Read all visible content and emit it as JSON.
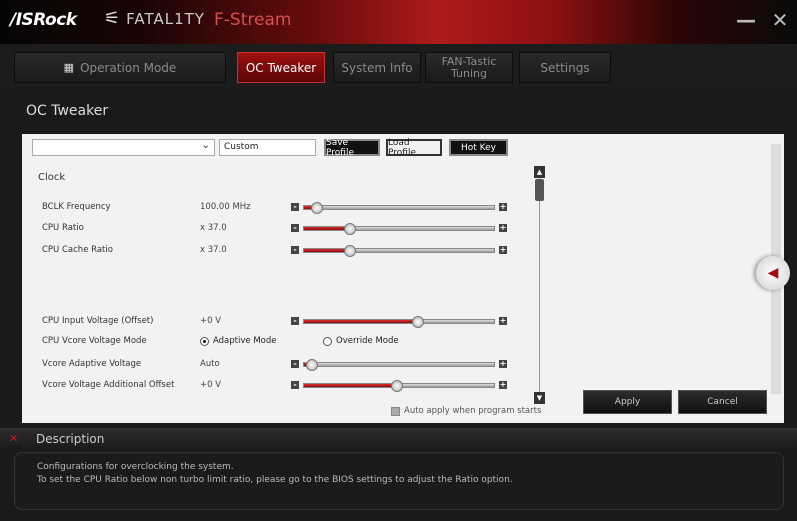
{
  "titlebar": {
    "brand": "/ISRock",
    "fatality_mark": "⚟",
    "fatality": "FATAL1TY",
    "app_name": "F-Stream",
    "minimize_icon": "minimize-icon",
    "close_icon": "close-icon"
  },
  "nav": {
    "operation_mode": "Operation Mode",
    "oc_tweaker": "OC Tweaker",
    "system_info": "System Info",
    "fan_tasic": "FAN-Tastic Tuning",
    "settings": "Settings"
  },
  "section_title": "OC Tweaker",
  "profile": {
    "dropdown_value": "",
    "profile_name": "Custom",
    "save_label": "Save Profile",
    "load_label": "Load Profile",
    "hotkey_label": "Hot Key"
  },
  "clock": {
    "group_label": "Clock",
    "rows": [
      {
        "label": "BCLK Frequency",
        "value": "100.00 MHz",
        "level": 0.07
      },
      {
        "label": "CPU Ratio",
        "value": "x 37.0",
        "level": 0.24
      },
      {
        "label": "CPU Cache Ratio",
        "value": "x 37.0",
        "level": 0.24
      }
    ]
  },
  "voltage": {
    "input_offset": {
      "label": "CPU Input Voltage (Offset)",
      "value": "+0 V",
      "level": 0.6
    },
    "vcore_mode": {
      "label": "CPU Vcore Voltage Mode",
      "adaptive": "Adaptive Mode",
      "override": "Override Mode",
      "selected": "Adaptive Mode"
    },
    "vcore_adaptive": {
      "label": "Vcore Adaptive Voltage",
      "value": "Auto",
      "level": 0.04
    },
    "vcore_additional": {
      "label": "Vcore Voltage Additional Offset",
      "value": "+0 V",
      "level": 0.49
    }
  },
  "auto_apply": "Auto apply when program starts",
  "actions": {
    "apply": "Apply",
    "cancel": "Cancel"
  },
  "description": {
    "title": "Description",
    "line1": "Configurations for overclocking the system.",
    "line2": "To set the CPU Ratio below non turbo limit ratio, please go to the BIOS settings to adjust the Ratio option."
  },
  "colors": {
    "accent": "#b01a1a",
    "panel": "#f2f2f2"
  }
}
